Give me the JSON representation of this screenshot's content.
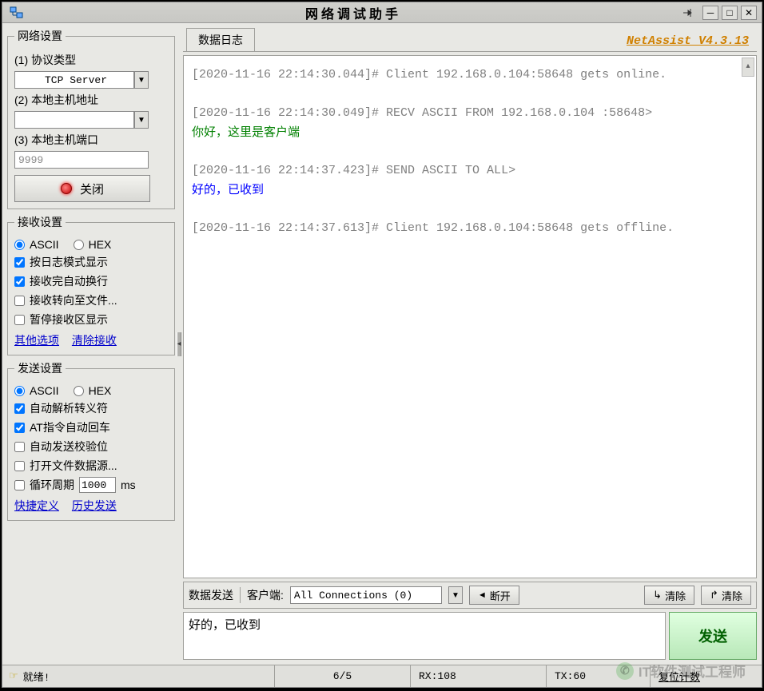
{
  "title": "网络调试助手",
  "version": "NetAssist V4.3.13",
  "net_settings": {
    "legend": "网络设置",
    "protocol_label": "(1) 协议类型",
    "protocol_value": "TCP Server",
    "host_label": "(2) 本地主机地址",
    "host_value": "",
    "port_label": "(3) 本地主机端口",
    "port_value": "9999",
    "close_btn": "关闭"
  },
  "recv_settings": {
    "legend": "接收设置",
    "opt_ascii": "ASCII",
    "opt_hex": "HEX",
    "chk1": "按日志模式显示",
    "chk2": "接收完自动换行",
    "chk3": "接收转向至文件...",
    "chk4": "暂停接收区显示",
    "link1": "其他选项",
    "link2": "清除接收"
  },
  "send_settings": {
    "legend": "发送设置",
    "opt_ascii": "ASCII",
    "opt_hex": "HEX",
    "chk1": "自动解析转义符",
    "chk2": "AT指令自动回车",
    "chk3": "自动发送校验位",
    "chk4": "打开文件数据源...",
    "chk5_label": "循环周期",
    "chk5_value": "1000",
    "chk5_unit": "ms",
    "link1": "快捷定义",
    "link2": "历史发送"
  },
  "log_tab": "数据日志",
  "log_lines": [
    {
      "text": "[2020-11-16 22:14:30.044]# Client 192.168.0.104:58648 gets online.",
      "cls": "log-line"
    },
    {
      "text": "",
      "cls": "log-line"
    },
    {
      "text": "[2020-11-16 22:14:30.049]# RECV ASCII FROM 192.168.0.104 :58648>",
      "cls": "log-line"
    },
    {
      "text": "你好，这里是客户端",
      "cls": "log-line green"
    },
    {
      "text": "",
      "cls": "log-line"
    },
    {
      "text": "[2020-11-16 22:14:37.423]# SEND ASCII TO ALL>",
      "cls": "log-line"
    },
    {
      "text": "好的，已收到",
      "cls": "log-line blue"
    },
    {
      "text": "",
      "cls": "log-line"
    },
    {
      "text": "[2020-11-16 22:14:37.613]# Client 192.168.0.104:58648 gets offline.",
      "cls": "log-line"
    }
  ],
  "send_panel": {
    "tab": "数据发送",
    "client_label": "客户端:",
    "conn_value": "All Connections (0)",
    "disconnect": "断开",
    "clear1": "清除",
    "clear2": "清除",
    "text": "好的，已收到",
    "send_btn": "发送"
  },
  "status": {
    "ready": "就绪!",
    "ratio": "6/5",
    "rx": "RX:108",
    "tx": "TX:60",
    "reset": "复位计数",
    "watermark": "IT软件测试工程师"
  }
}
